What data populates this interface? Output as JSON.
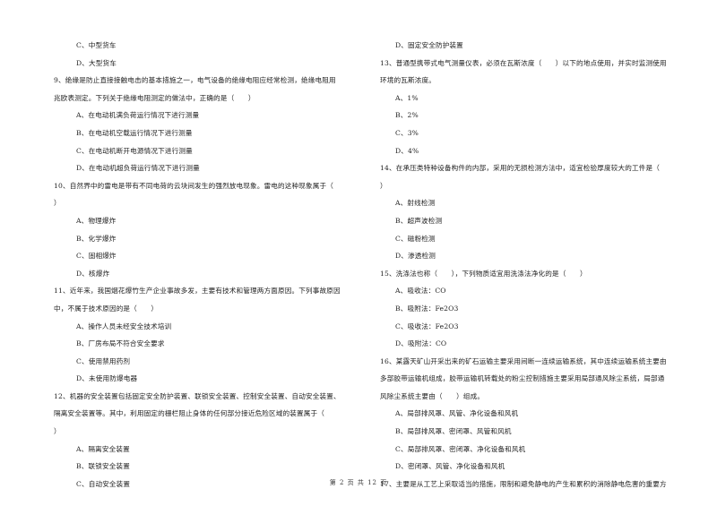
{
  "left_column": [
    {
      "type": "option",
      "text": "C、中型货车"
    },
    {
      "type": "option",
      "text": "D、大型货车"
    },
    {
      "type": "question",
      "text": "9、绝缘是防止直接接触电击的基本措施之一，电气设备的绝缘电阻应经常检测，绝缘电阻用"
    },
    {
      "type": "question",
      "text": "兆欧表测定。下列关于绝缘电阻测定的做法中，正确的是（　　）"
    },
    {
      "type": "option",
      "text": "A、在电动机满负荷运行情况下进行测量"
    },
    {
      "type": "option",
      "text": "B、在电动机空载运行情况下进行测量"
    },
    {
      "type": "option",
      "text": "C、在电动机断开电源情况下进行测量"
    },
    {
      "type": "option",
      "text": "D、在电动机超负荷运行情况下进行测量"
    },
    {
      "type": "question",
      "text": "10、自然界中的雷电是带有不同电荷的云块间发生的强烈放电现象。雷电的这种现象属于（"
    },
    {
      "type": "question",
      "text": "）"
    },
    {
      "type": "option",
      "text": "A、物理爆炸"
    },
    {
      "type": "option",
      "text": "B、化学爆炸"
    },
    {
      "type": "option",
      "text": "C、固相爆炸"
    },
    {
      "type": "option",
      "text": "D、核爆炸"
    },
    {
      "type": "question",
      "text": "11、近年来，我国烟花爆竹生产企业事故多发，主要有技术和管理两方面原因。下列事故原因"
    },
    {
      "type": "question",
      "text": "中，不属于技术原因的是（　　）"
    },
    {
      "type": "option",
      "text": "A、操作人员未经安全技术培训"
    },
    {
      "type": "option",
      "text": "B、厂房布局不符合安全要求"
    },
    {
      "type": "option",
      "text": "C、使用禁用药剂"
    },
    {
      "type": "option",
      "text": "D、未使用防爆电器"
    },
    {
      "type": "question",
      "text": "12、机器的安全装置包括固定安全防护装置、联锁安全装置、控制安全装置、自动安全装置、"
    },
    {
      "type": "question",
      "text": "隔离安全装置等。其中，利用固定的栅栏阻止身体的任何部分接近危险区域的装置属于（"
    },
    {
      "type": "question",
      "text": "）"
    },
    {
      "type": "option",
      "text": "A、隔离安全装置"
    },
    {
      "type": "option",
      "text": "B、联锁安全装置"
    },
    {
      "type": "option",
      "text": "C、自动安全装置"
    }
  ],
  "right_column": [
    {
      "type": "option",
      "text": "D、固定安全防护装置"
    },
    {
      "type": "question",
      "text": "13、普通型携带式电气测量仪表，必须在瓦斯浓度（　　）以下的地点使用，并实时监测使用"
    },
    {
      "type": "question",
      "text": "环境的瓦斯浓度。"
    },
    {
      "type": "option",
      "text": "A、1%"
    },
    {
      "type": "option",
      "text": "B、2%"
    },
    {
      "type": "option",
      "text": "C、3%"
    },
    {
      "type": "option",
      "text": "D、4%"
    },
    {
      "type": "question",
      "text": "14、在承压类特种设备构件的内部，采用的无损检测方法中，适宜检验厚度较大的工件是（"
    },
    {
      "type": "question",
      "text": "）"
    },
    {
      "type": "option",
      "text": "A、射线检测"
    },
    {
      "type": "option",
      "text": "B、超声波检测"
    },
    {
      "type": "option",
      "text": "C、磁粉检测"
    },
    {
      "type": "option",
      "text": "D、渗透检测"
    },
    {
      "type": "question",
      "text": "15、洗涤法也称（　　），下列物质适宜用洗涤法净化的是（　　）"
    },
    {
      "type": "option",
      "text": "A、吸收法：CO"
    },
    {
      "type": "option",
      "text": "B、吸附法：Fe2O3"
    },
    {
      "type": "option",
      "text": "C、吸收法：Fe2O3"
    },
    {
      "type": "option",
      "text": "D、吸附法：CO"
    },
    {
      "type": "question",
      "text": "16、某露天矿山开采出来的矿石运输主要采用间断一连续运输系统，其中连续运输系统主要由"
    },
    {
      "type": "question",
      "text": "多部胶带运输机组成，胶带运输机转载处的粉尘控制措施主要采用局部通风除尘系统，局部通"
    },
    {
      "type": "question",
      "text": "风除尘系统主要由（　　）组成。"
    },
    {
      "type": "option",
      "text": "A、局部排风罩、风管、净化设备和风机"
    },
    {
      "type": "option",
      "text": "B、局部排风罩、密闭罩、风管和风机"
    },
    {
      "type": "option",
      "text": "C、局部排风罩、密闭罩、净化设备和风机"
    },
    {
      "type": "option",
      "text": "D、密闭罩、风管、净化设备和风机"
    },
    {
      "type": "question",
      "text": "17、主要是从工艺上采取适当的措施，限制和避免静电的产生和累积的消除静电危害的重要方"
    }
  ],
  "footer": {
    "page_label": "第 2 页 共 12 页"
  }
}
